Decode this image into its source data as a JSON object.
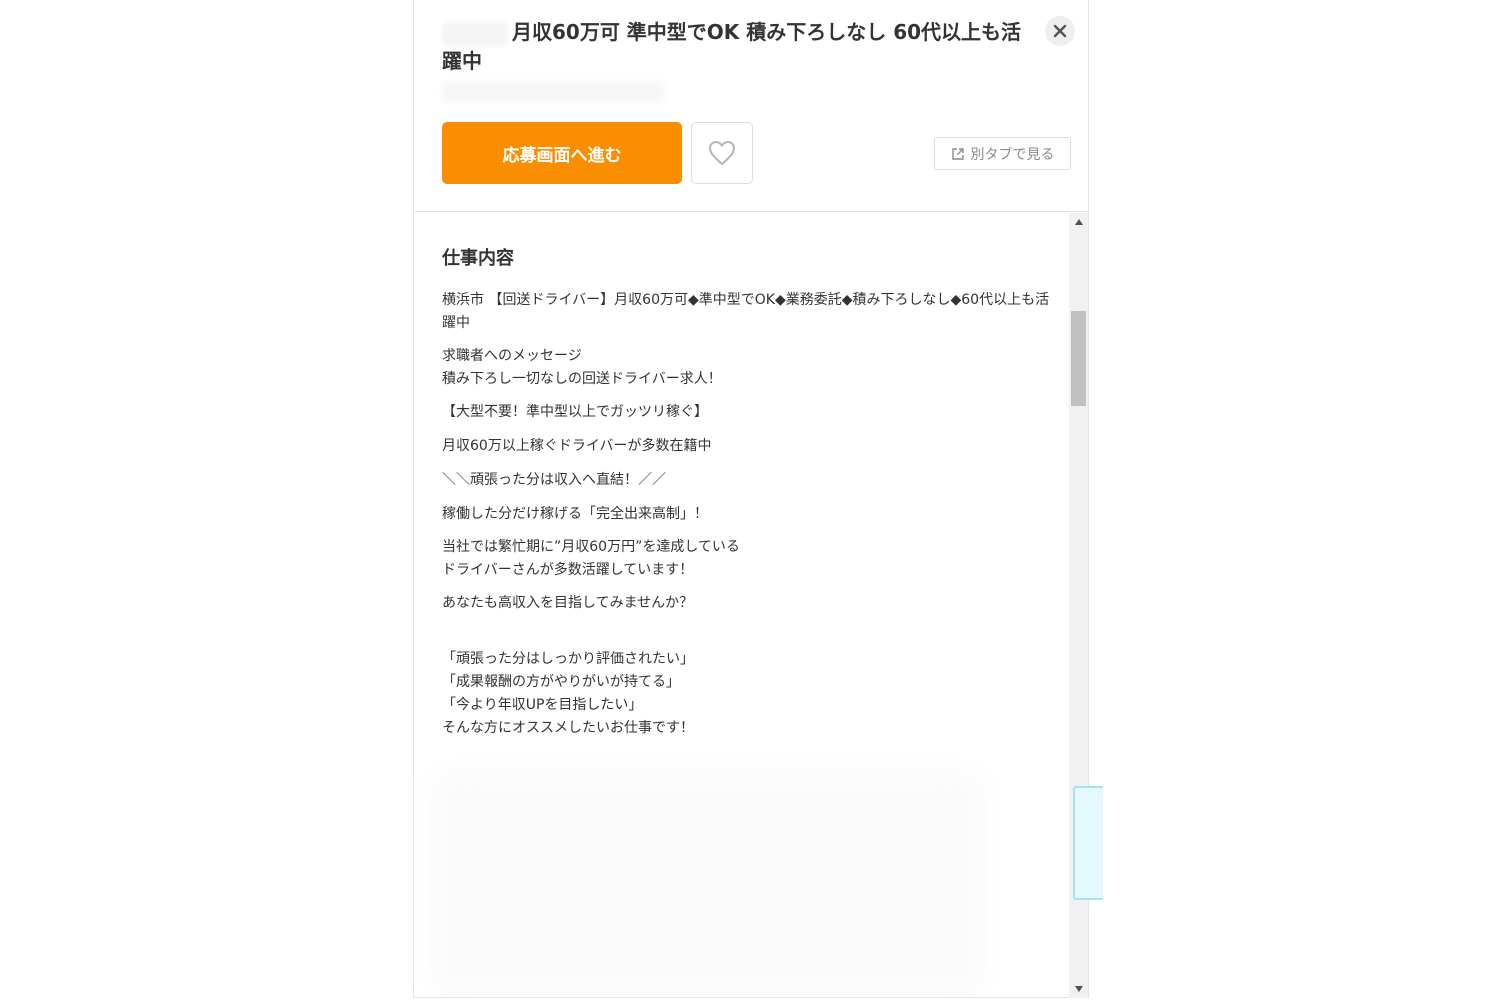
{
  "job": {
    "title": "月収60万可 準中型でOK 積み下ろしなし 60代以上も活躍中"
  },
  "actions": {
    "apply_label": "応募画面へ進む",
    "favorite_icon": "heart-icon",
    "new_tab_label": "別タブで見る",
    "new_tab_icon": "external-link-icon",
    "close_icon": "close-icon"
  },
  "colors": {
    "accent": "#f98e00",
    "side_tab": "#e3f9fd"
  },
  "section": {
    "title": "仕事内容",
    "paragraphs": [
      "横浜市 【回送ドライバー】月収60万可◆準中型でOK◆業務委託◆積み下ろしなし◆60代以上も活躍中",
      "求職者へのメッセージ\n積み下ろし一切なしの回送ドライバー求人！",
      "【大型不要！準中型以上でガッツリ稼ぐ】",
      "月収60万以上稼ぐドライバーが多数在籍中",
      "＼＼頑張った分は収入へ直結！／／",
      "稼働した分だけ稼げる「完全出来高制」！",
      "当社では繁忙期に”月収60万円”を達成している\nドライバーさんが多数活躍しています！",
      "あなたも高収入を目指してみませんか？",
      "「頑張った分はしっかり評価されたい」\n「成果報酬の方がやりがいが持てる」\n「今より年収UPを目指したい」\nそんな方にオススメしたいお仕事です！"
    ]
  }
}
